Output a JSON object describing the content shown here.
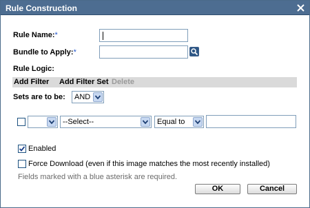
{
  "dialog": {
    "title": "Rule Construction",
    "close_icon": "close-icon"
  },
  "form": {
    "rule_name_label": "Rule Name:",
    "rule_name_value": "",
    "bundle_label": "Bundle to Apply:",
    "bundle_value": "",
    "required_marker": "*",
    "rule_logic_label": "Rule Logic:"
  },
  "toolbar": {
    "add_filter": "Add Filter",
    "add_filter_set": "Add Filter Set",
    "delete": "Delete"
  },
  "sets": {
    "label": "Sets are to be:",
    "value": "AND"
  },
  "filter_row": {
    "first_select_value": "",
    "field_select_value": "--Select--",
    "operator_select_value": "Equal to",
    "value_input": ""
  },
  "options": {
    "enabled_label": "Enabled",
    "enabled_checked": true,
    "force_download_label": "Force Download (even if this image matches the most recently installed)",
    "force_download_checked": false
  },
  "hint": "Fields marked with a blue asterisk are required.",
  "buttons": {
    "ok": "OK",
    "cancel": "Cancel"
  },
  "colors": {
    "titlebar": "#4d6d91",
    "required_asterisk": "#2255cc",
    "toolbar_bg": "#dadada"
  }
}
